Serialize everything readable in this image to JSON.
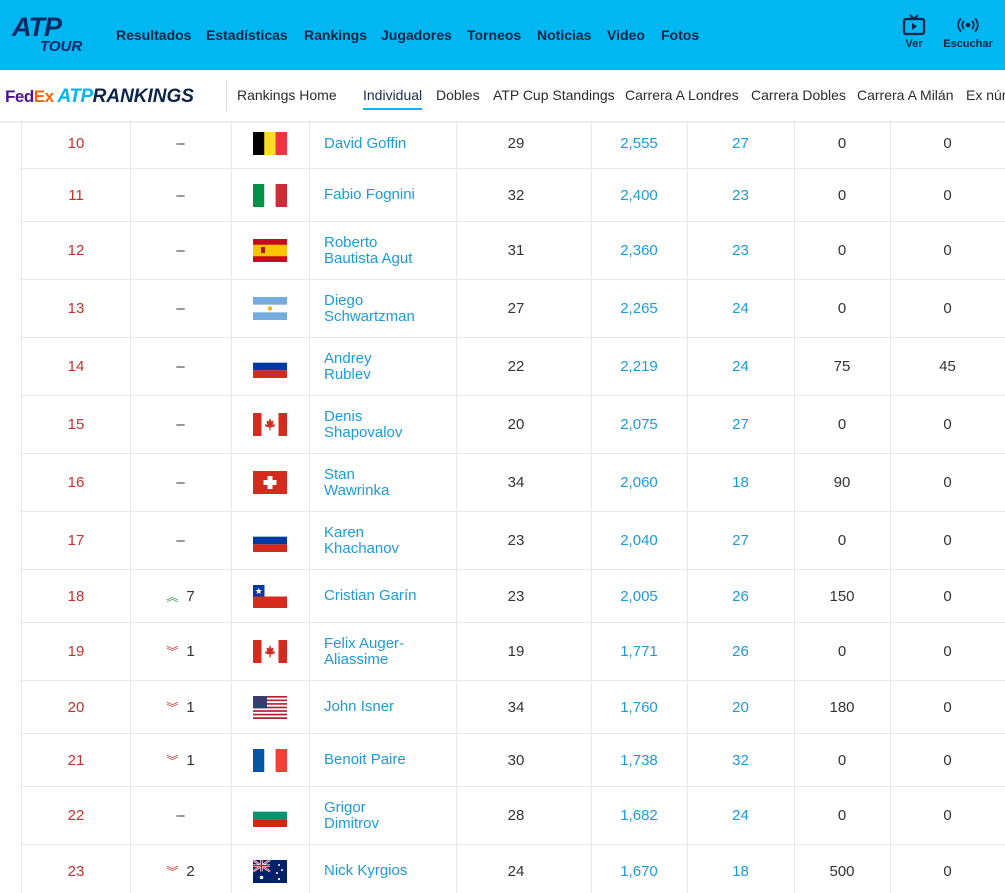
{
  "topnav": {
    "logo_text": "ATP",
    "logo_sub": "TOUR",
    "items": [
      "Resultados",
      "Estadísticas",
      "Rankings",
      "Jugadores",
      "Torneos",
      "Noticias",
      "Video",
      "Fotos"
    ],
    "watch_label": "Ver",
    "listen_label": "Escuchar"
  },
  "subnav": {
    "brand": {
      "fed": "Fed",
      "ex": "Ex",
      "atp": "ATP",
      "rankings": "RANKINGS"
    },
    "items": [
      "Rankings Home",
      "Individual",
      "Dobles",
      "ATP Cup Standings",
      "Carrera A Londres",
      "Carrera Dobles",
      "Carrera A Milán",
      "Ex núm"
    ],
    "active": "Individual"
  },
  "colors": {
    "accent": "#00b7f1",
    "navy": "#0b2447",
    "rank_red": "#c4322f",
    "link_blue": "#1e9bd7",
    "up_green": "#2e9e4f"
  },
  "rows": [
    {
      "rank": "10",
      "move": "–",
      "dir": "none",
      "flag": "BEL",
      "name1": "David Goffin",
      "name2": "",
      "age": "29",
      "points": "2,555",
      "tournaments": "27",
      "dropping": "0",
      "next": "0"
    },
    {
      "rank": "11",
      "move": "–",
      "dir": "none",
      "flag": "ITA",
      "name1": "Fabio Fognini",
      "name2": "",
      "age": "32",
      "points": "2,400",
      "tournaments": "23",
      "dropping": "0",
      "next": "0"
    },
    {
      "rank": "12",
      "move": "–",
      "dir": "none",
      "flag": "ESP",
      "name1": "Roberto",
      "name2": "Bautista Agut",
      "age": "31",
      "points": "2,360",
      "tournaments": "23",
      "dropping": "0",
      "next": "0"
    },
    {
      "rank": "13",
      "move": "–",
      "dir": "none",
      "flag": "ARG",
      "name1": "Diego",
      "name2": "Schwartzman",
      "age": "27",
      "points": "2,265",
      "tournaments": "24",
      "dropping": "0",
      "next": "0"
    },
    {
      "rank": "14",
      "move": "–",
      "dir": "none",
      "flag": "RUS",
      "name1": "Andrey",
      "name2": "Rublev",
      "age": "22",
      "points": "2,219",
      "tournaments": "24",
      "dropping": "75",
      "next": "45"
    },
    {
      "rank": "15",
      "move": "–",
      "dir": "none",
      "flag": "CAN",
      "name1": "Denis",
      "name2": "Shapovalov",
      "age": "20",
      "points": "2,075",
      "tournaments": "27",
      "dropping": "0",
      "next": "0"
    },
    {
      "rank": "16",
      "move": "–",
      "dir": "none",
      "flag": "SUI",
      "name1": "Stan",
      "name2": "Wawrinka",
      "age": "34",
      "points": "2,060",
      "tournaments": "18",
      "dropping": "90",
      "next": "0"
    },
    {
      "rank": "17",
      "move": "–",
      "dir": "none",
      "flag": "RUS",
      "name1": "Karen",
      "name2": "Khachanov",
      "age": "23",
      "points": "2,040",
      "tournaments": "27",
      "dropping": "0",
      "next": "0"
    },
    {
      "rank": "18",
      "move": "7",
      "dir": "up",
      "flag": "CHI",
      "name1": "Cristian Garín",
      "name2": "",
      "age": "23",
      "points": "2,005",
      "tournaments": "26",
      "dropping": "150",
      "next": "0"
    },
    {
      "rank": "19",
      "move": "1",
      "dir": "down",
      "flag": "CAN",
      "name1": "Felix Auger-",
      "name2": "Aliassime",
      "age": "19",
      "points": "1,771",
      "tournaments": "26",
      "dropping": "0",
      "next": "0"
    },
    {
      "rank": "20",
      "move": "1",
      "dir": "down",
      "flag": "USA",
      "name1": "John Isner",
      "name2": "",
      "age": "34",
      "points": "1,760",
      "tournaments": "20",
      "dropping": "180",
      "next": "0"
    },
    {
      "rank": "21",
      "move": "1",
      "dir": "down",
      "flag": "FRA",
      "name1": "Benoit Paire",
      "name2": "",
      "age": "30",
      "points": "1,738",
      "tournaments": "32",
      "dropping": "0",
      "next": "0"
    },
    {
      "rank": "22",
      "move": "–",
      "dir": "none",
      "flag": "BUL",
      "name1": "Grigor",
      "name2": "Dimitrov",
      "age": "28",
      "points": "1,682",
      "tournaments": "24",
      "dropping": "0",
      "next": "0"
    },
    {
      "rank": "23",
      "move": "2",
      "dir": "down",
      "flag": "AUS",
      "name1": "Nick Kyrgios",
      "name2": "",
      "age": "24",
      "points": "1,670",
      "tournaments": "18",
      "dropping": "500",
      "next": "0"
    }
  ]
}
